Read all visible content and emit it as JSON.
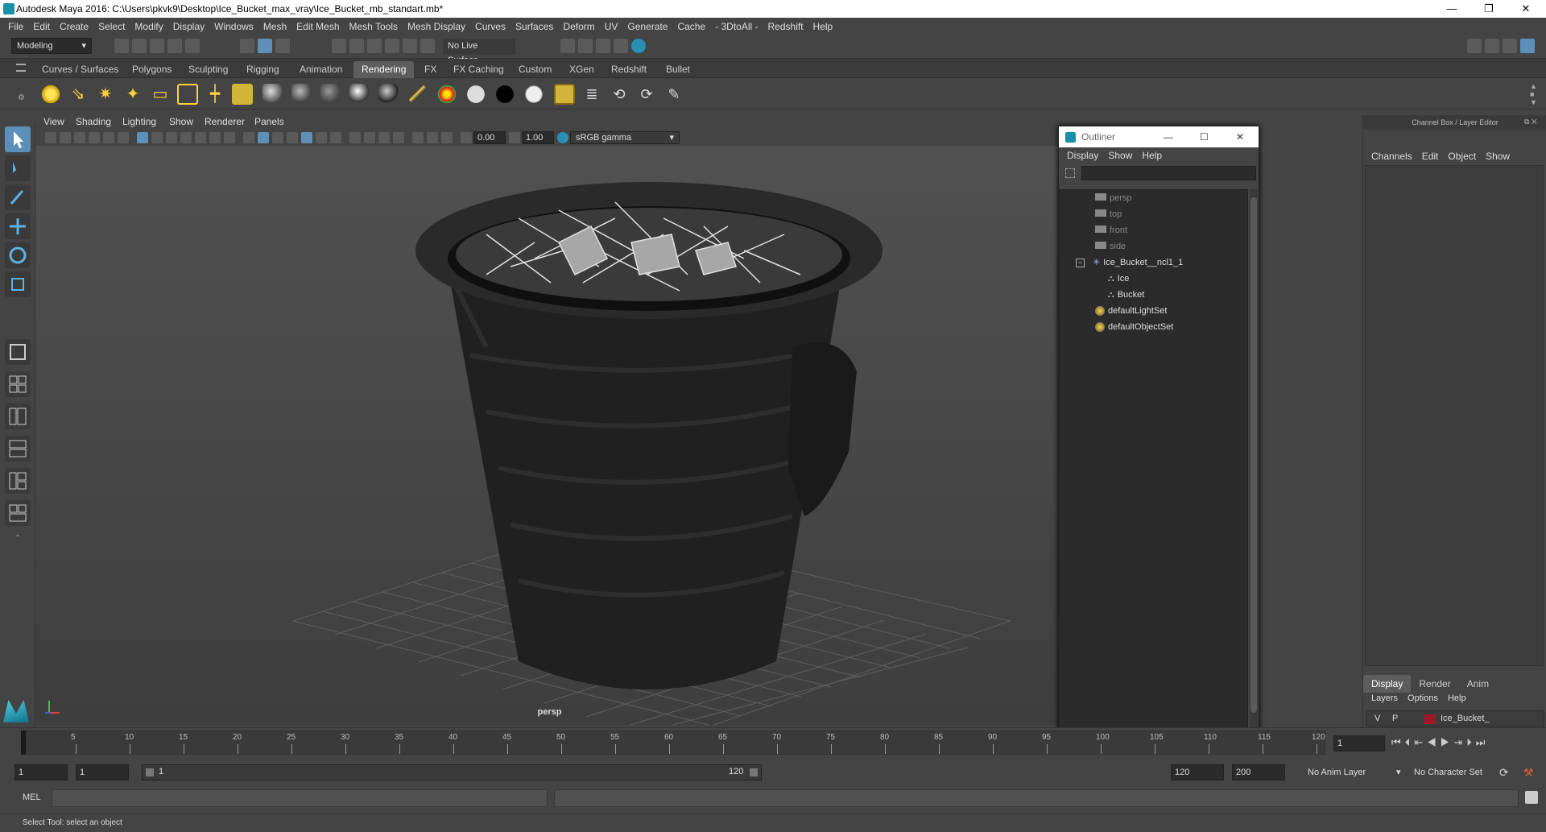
{
  "title": "Autodesk Maya 2016: C:\\Users\\pkvk9\\Desktop\\Ice_Bucket_max_vray\\Ice_Bucket_mb_standart.mb*",
  "menu": [
    "File",
    "Edit",
    "Create",
    "Select",
    "Modify",
    "Display",
    "Windows",
    "Mesh",
    "Edit Mesh",
    "Mesh Tools",
    "Mesh Display",
    "Curves",
    "Surfaces",
    "Deform",
    "UV",
    "Generate",
    "Cache",
    "- 3DtoAll -",
    "Redshift",
    "Help"
  ],
  "status": {
    "mode": "Modeling",
    "live_surface": "No Live Surface"
  },
  "shelf_tabs": [
    "Curves / Surfaces",
    "Polygons",
    "Sculpting",
    "Rigging",
    "Animation",
    "Rendering",
    "FX",
    "FX Caching",
    "Custom",
    "XGen",
    "Redshift",
    "Bullet"
  ],
  "active_shelf_tab": "Rendering",
  "viewport": {
    "menu": [
      "View",
      "Shading",
      "Lighting",
      "Show",
      "Renderer",
      "Panels"
    ],
    "exposure": "0.00",
    "gamma": "1.00",
    "colorspace": "sRGB gamma",
    "camera_label": "persp"
  },
  "outliner": {
    "title": "Outliner",
    "menu": [
      "Display",
      "Show",
      "Help"
    ],
    "items": [
      {
        "label": "persp",
        "icon": "camera-icon"
      },
      {
        "label": "top",
        "icon": "camera-icon"
      },
      {
        "label": "front",
        "icon": "camera-icon"
      },
      {
        "label": "side",
        "icon": "camera-icon"
      },
      {
        "label": "Ice_Bucket__ncl1_1",
        "icon": "group-icon"
      },
      {
        "label": "Ice",
        "icon": "mesh-icon"
      },
      {
        "label": "Bucket",
        "icon": "mesh-icon"
      },
      {
        "label": "defaultLightSet",
        "icon": "set-icon"
      },
      {
        "label": "defaultObjectSet",
        "icon": "set-icon"
      }
    ]
  },
  "channel_box": {
    "header": "Channel Box / Layer Editor",
    "menu": [
      "Channels",
      "Edit",
      "Object",
      "Show"
    ],
    "tabs": [
      "Display",
      "Render",
      "Anim"
    ],
    "layer_menu": [
      "Layers",
      "Options",
      "Help"
    ],
    "layer": {
      "v": "V",
      "p": "P",
      "name": "Ice_Bucket_",
      "color": "#a0182e"
    }
  },
  "timeline": {
    "ticks": [
      "5",
      "10",
      "15",
      "20",
      "25",
      "30",
      "35",
      "40",
      "45",
      "50",
      "55",
      "60",
      "65",
      "70",
      "75",
      "80",
      "85",
      "90",
      "95",
      "100",
      "105",
      "110",
      "115",
      "120"
    ],
    "current_frame": "1",
    "start_field": "1",
    "start_field2": "1",
    "range_start": "1",
    "range_end": "120",
    "end_field": "120",
    "end_field2": "200",
    "anim_layer": "No Anim Layer",
    "character_set": "No Character Set"
  },
  "command": {
    "lang": "MEL"
  },
  "help_line": "Select Tool: select an object"
}
